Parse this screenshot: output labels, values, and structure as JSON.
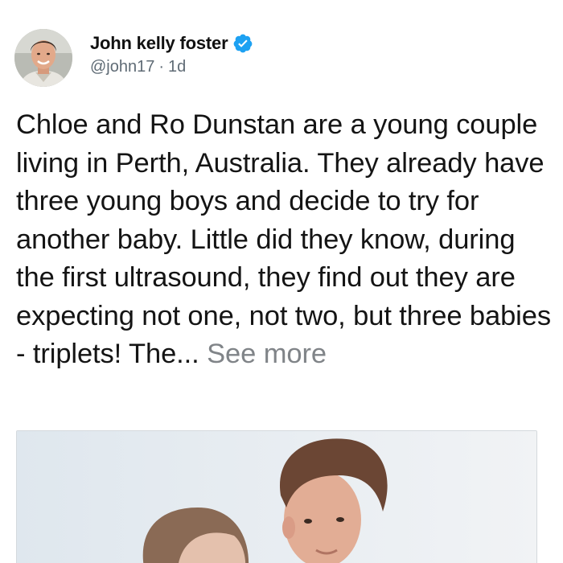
{
  "post": {
    "author": {
      "display_name": "John kelly foster",
      "handle": "@john17",
      "time_ago": "1d",
      "verified": true,
      "avatar_icon": "avatar-photo"
    },
    "body_text": "Chloe and Ro Dunstan are a young couple living in Perth, Australia. They already have three young boys and decide to try for another baby. Little did they know, during the first ultrasound, they find out they are expecting not one, not two, but three babies - triplets! The...",
    "see_more_label": "See more",
    "media": {
      "type": "photo"
    }
  },
  "colors": {
    "verified_badge": "#1DA1F2",
    "see_more": "#808488",
    "handle": "#5f6b75",
    "text": "#141414"
  }
}
